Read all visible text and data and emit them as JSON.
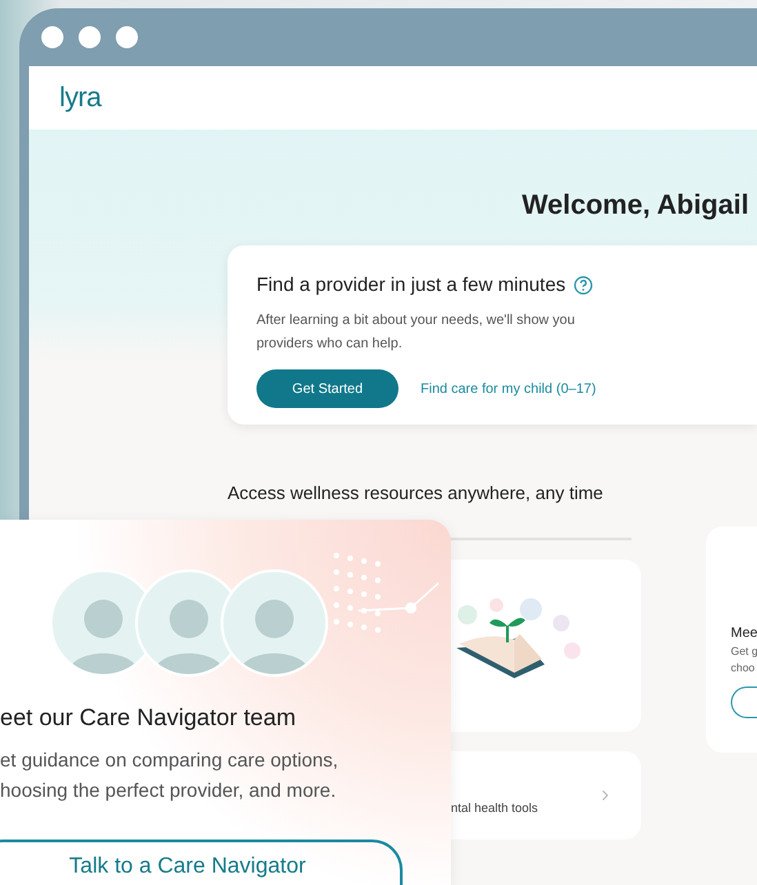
{
  "browser": {
    "logo": "lyra"
  },
  "hero": {
    "title": "Welcome, Abigail"
  },
  "provider_card": {
    "title": "Find a provider in just a few minutes",
    "description": "After learning a bit about your needs, we'll show you providers who can help.",
    "primary_button": "Get Started",
    "link": "Find care for my child (0–17)"
  },
  "wellness": {
    "title": "Access wellness resources anywhere, any time",
    "tools_card": {
      "text": "ntal health tools"
    }
  },
  "side_card": {
    "title": "Mee",
    "lines": [
      "Get g",
      "choo"
    ]
  },
  "navigator_card": {
    "title": "eet our Care Navigator team",
    "lines": [
      "et guidance on comparing care options,",
      "hoosing the perfect provider, and more."
    ],
    "button": "Talk to a Care Navigator",
    "avatars": [
      {
        "color": "#e4f3f2"
      },
      {
        "color": "#e4f3f2"
      },
      {
        "color": "#e4f3f2"
      }
    ]
  }
}
